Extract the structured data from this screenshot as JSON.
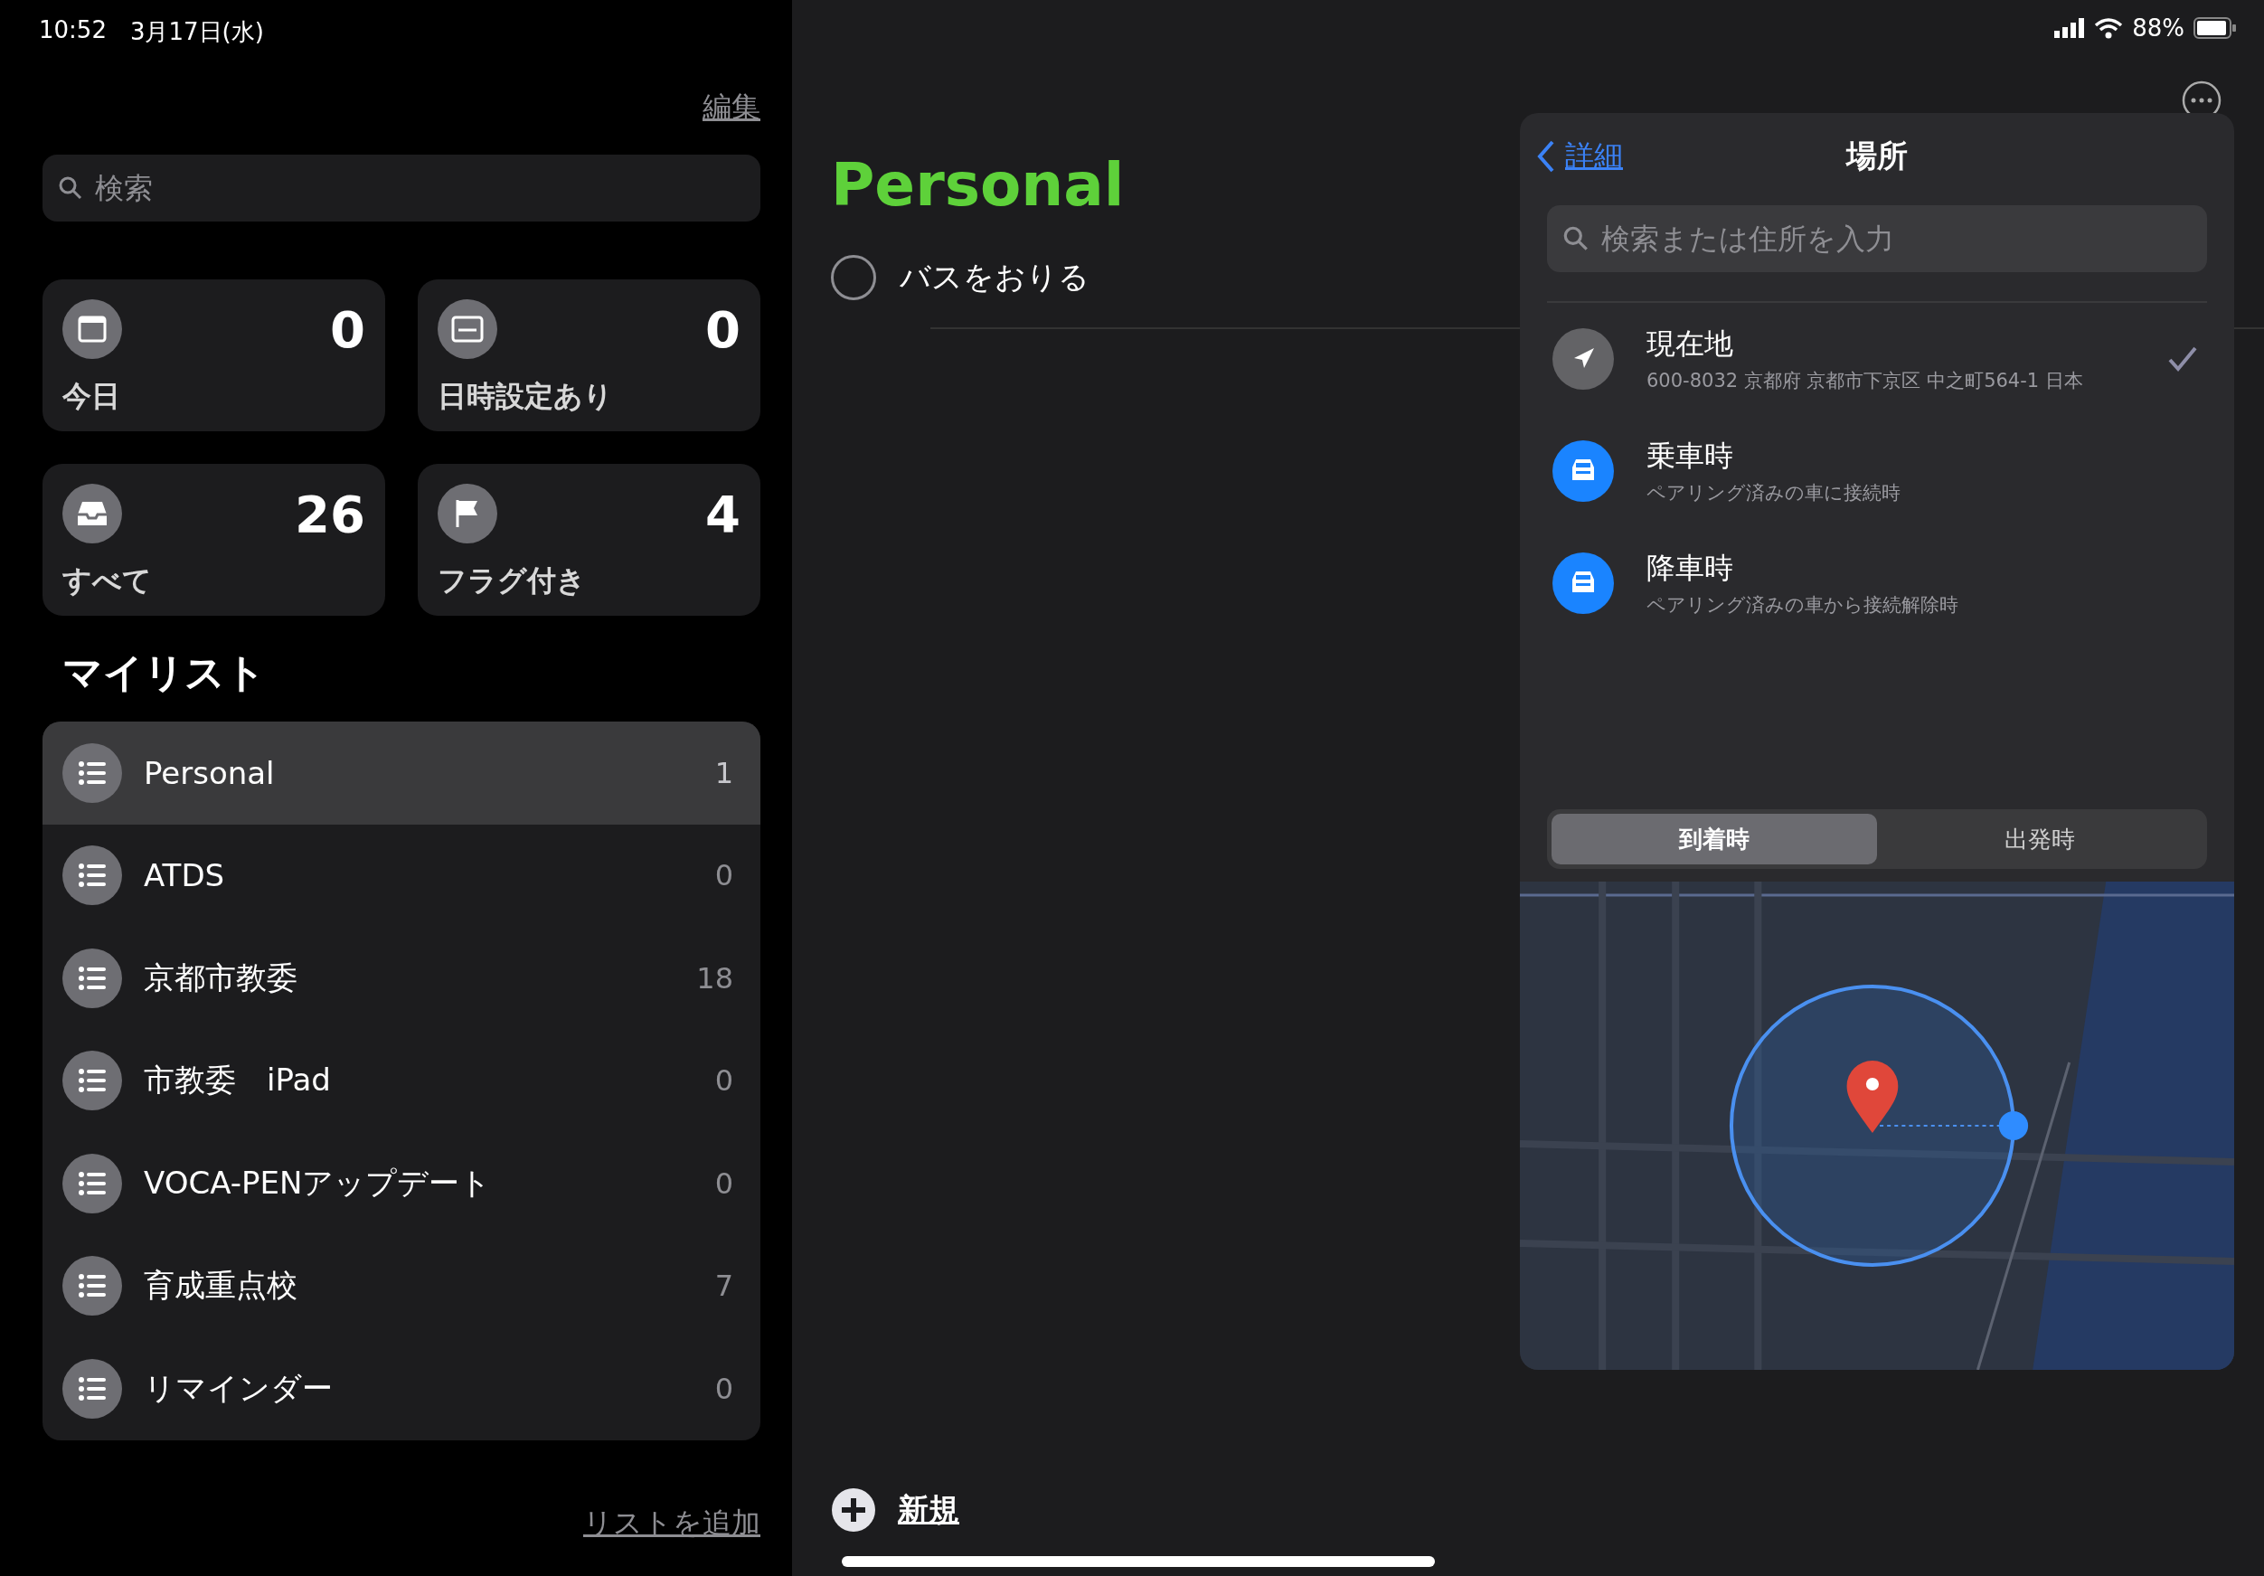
{
  "status_bar": {
    "time": "10:52",
    "date": "3月17日(水)",
    "battery": "88%"
  },
  "sidebar": {
    "edit": "編集",
    "search": {
      "placeholder": "検索"
    },
    "smart_lists": [
      {
        "kind": "today",
        "label": "今日",
        "count": "0"
      },
      {
        "kind": "scheduled",
        "label": "日時設定あり",
        "count": "0"
      },
      {
        "kind": "all",
        "label": "すべて",
        "count": "26"
      },
      {
        "kind": "flagged",
        "label": "フラグ付き",
        "count": "4"
      }
    ],
    "my_lists_heading": "マイリスト",
    "lists": [
      {
        "name": "Personal",
        "count": "1",
        "selected": true
      },
      {
        "name": "ATDS",
        "count": "0",
        "selected": false
      },
      {
        "name": "京都市教委",
        "count": "18",
        "selected": false
      },
      {
        "name": "市教委　iPad",
        "count": "0",
        "selected": false
      },
      {
        "name": "VOCA-PENアップデート",
        "count": "0",
        "selected": false
      },
      {
        "name": "育成重点校",
        "count": "7",
        "selected": false
      },
      {
        "name": "リマインダー",
        "count": "0",
        "selected": false
      }
    ],
    "add_list": "リストを追加"
  },
  "main": {
    "title": "Personal",
    "reminders": [
      {
        "text": "バスをおりる",
        "completed": false
      }
    ],
    "new_button": "新規"
  },
  "popover": {
    "back": "詳細",
    "title": "場所",
    "search": {
      "placeholder": "検索または住所を入力"
    },
    "options": [
      {
        "kind": "current",
        "title": "現在地",
        "subtitle": "600-8032 京都府 京都市下京区 中之町564-1 日本",
        "selected": true
      },
      {
        "kind": "car",
        "title": "乗車時",
        "subtitle": "ペアリング済みの車に接続時",
        "selected": false
      },
      {
        "kind": "car",
        "title": "降車時",
        "subtitle": "ペアリング済みの車から接続解除時",
        "selected": false
      }
    ],
    "segments": [
      {
        "label": "到着時",
        "selected": true
      },
      {
        "label": "出発時",
        "selected": false
      }
    ]
  }
}
